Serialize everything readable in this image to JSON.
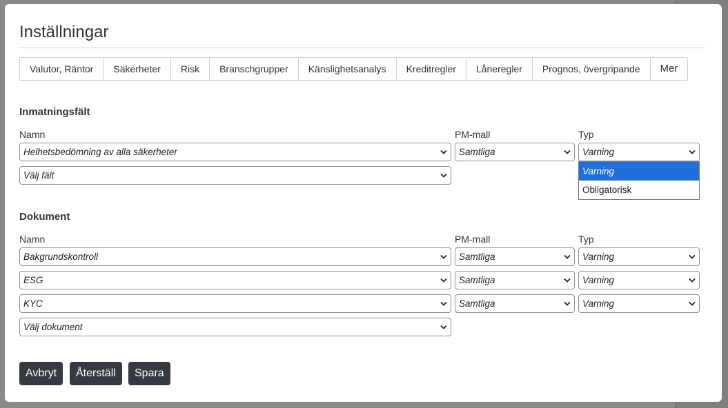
{
  "dialog": {
    "title": "Inställningar"
  },
  "tabs": [
    {
      "label": "Valutor, Räntor"
    },
    {
      "label": "Säkerheter"
    },
    {
      "label": "Risk"
    },
    {
      "label": "Branschgrupper"
    },
    {
      "label": "Känslighetsanalys"
    },
    {
      "label": "Kreditregler"
    },
    {
      "label": "Låneregler"
    },
    {
      "label": "Prognos, övergripande"
    },
    {
      "label": "Mer"
    }
  ],
  "inmatning": {
    "heading": "Inmatningsfält",
    "col_namn": "Namn",
    "col_pm": "PM-mall",
    "col_typ": "Typ",
    "rows": [
      {
        "namn": "Helhetsbedömning av alla säkerheter",
        "pm": "Samtliga",
        "typ": "Varning"
      }
    ],
    "add_placeholder": "Välj fält",
    "typ_dropdown": {
      "options": [
        "Varning",
        "Obligatorisk"
      ],
      "selected": "Varning"
    }
  },
  "dokument": {
    "heading": "Dokument",
    "col_namn": "Namn",
    "col_pm": "PM-mall",
    "col_typ": "Typ",
    "rows": [
      {
        "namn": "Bakgrundskontroll",
        "pm": "Samtliga",
        "typ": "Varning"
      },
      {
        "namn": "ESG",
        "pm": "Samtliga",
        "typ": "Varning"
      },
      {
        "namn": "KYC",
        "pm": "Samtliga",
        "typ": "Varning"
      }
    ],
    "add_placeholder": "Välj dokument"
  },
  "buttons": {
    "cancel": "Avbryt",
    "reset": "Återställ",
    "save": "Spara"
  },
  "colors": {
    "button_bg": "#343a40",
    "selected_option_bg": "#1e6fd9"
  }
}
